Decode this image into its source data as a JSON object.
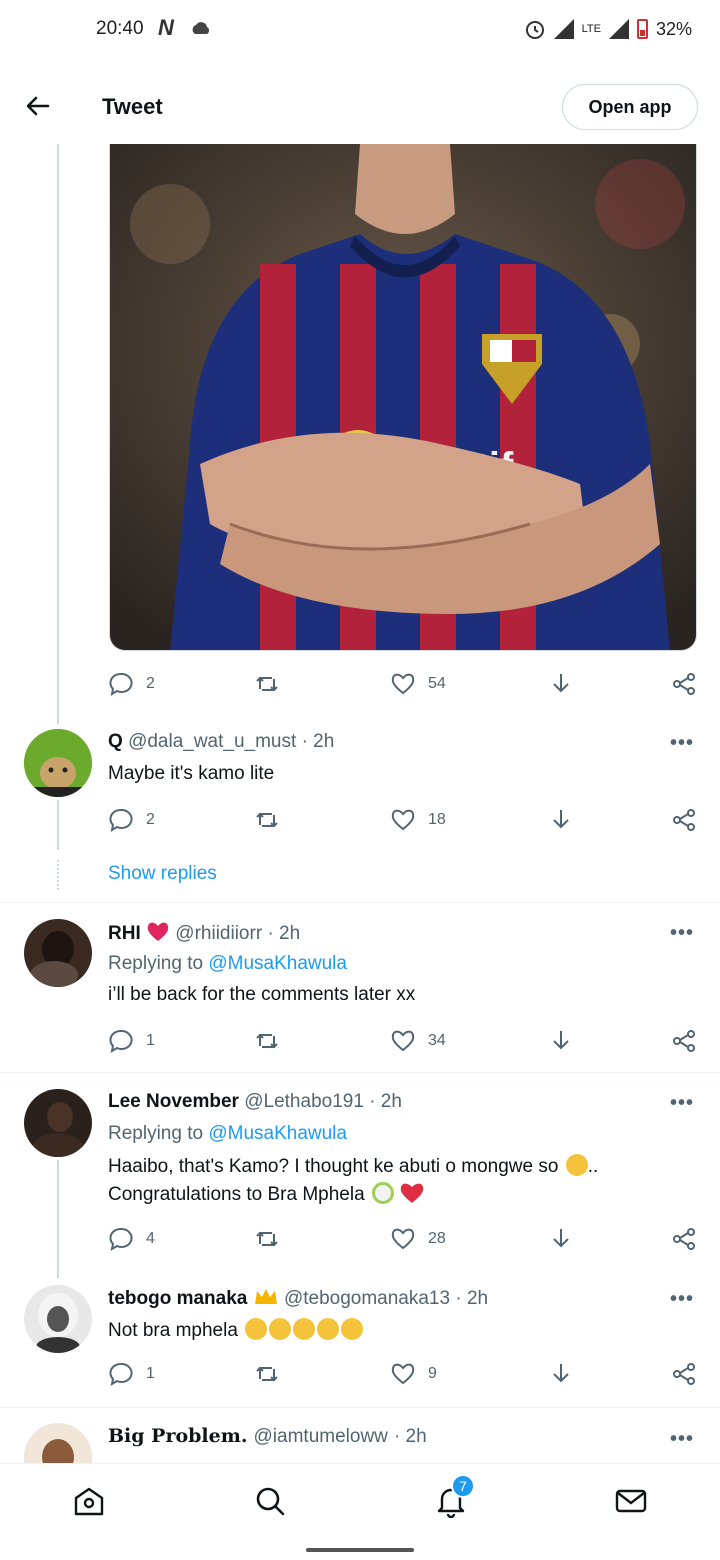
{
  "status_bar": {
    "time": "20:40",
    "carrier_glyph": "N",
    "battery": "32%",
    "network": "LTE"
  },
  "header": {
    "title": "Tweet",
    "open_app": "Open app"
  },
  "media_tweet": {
    "replies": "2",
    "likes": "54"
  },
  "tweets": [
    {
      "name": "Q",
      "handle": "@dala_wat_u_must",
      "time": "· 2h",
      "text": "Maybe it's kamo lite",
      "replies": "2",
      "likes": "18",
      "show_replies": "Show replies"
    },
    {
      "name": "RHI",
      "handle": "@rhiidiiorr",
      "time": "· 2h",
      "replying_label": "Replying to",
      "replying_to": "@MusaKhawula",
      "text": "i’ll be back for the comments later xx",
      "replies": "1",
      "likes": "34"
    },
    {
      "name": "Lee November",
      "handle": "@Lethabo191",
      "time": "· 2h",
      "replying_label": "Replying to",
      "replying_to": "@MusaKhawula",
      "text_line1": "Haaibo, that's Kamo? I thought ke abuti o mongwe so",
      "text_line1_end": "..",
      "text_line2": "Congratulations to Bra Mphela",
      "replies": "4",
      "likes": "28"
    },
    {
      "name": "tebogo manaka",
      "handle": "@tebogomanaka13",
      "time": "· 2h",
      "text": "Not bra mphela",
      "replies": "1",
      "likes": "9"
    },
    {
      "name": "Big Problem.",
      "handle": "@iamtumeloww",
      "time": "· 2h"
    }
  ],
  "bottom_nav": {
    "notifications_badge": "7"
  },
  "icons": [
    "back-arrow-icon",
    "reply-icon",
    "retweet-icon",
    "like-icon",
    "download-icon",
    "share-icon",
    "home-icon",
    "search-icon",
    "bell-icon",
    "mail-icon",
    "more-icon"
  ],
  "colors": {
    "accent": "#1d9bf0",
    "text": "#0f1419",
    "muted": "#536471",
    "heart_emoji": "#e0245e"
  }
}
